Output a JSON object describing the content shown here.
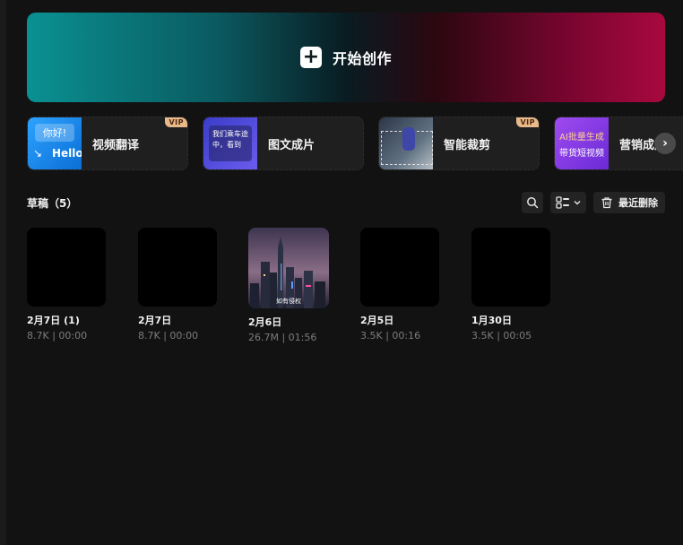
{
  "hero": {
    "label": "开始创作",
    "plus_icon": "plus-icon"
  },
  "tools": [
    {
      "label": "视频翻译",
      "vip": "VIP",
      "thumb_top": "你好!",
      "thumb_bottom": "Hello"
    },
    {
      "label": "图文成片",
      "thumb_text": "我们乘车途中，看到"
    },
    {
      "label": "智能裁剪",
      "vip": "VIP"
    },
    {
      "label": "营销成片",
      "thumb_l1": "AI批量生成",
      "thumb_l2": "带货短视频"
    }
  ],
  "drafts": {
    "title": "草稿（5）",
    "delete_label": "最近删除",
    "items": [
      {
        "title": "2月7日 (1)",
        "meta": "8.7K | 00:00"
      },
      {
        "title": "2月7日",
        "meta": "8.7K | 00:00"
      },
      {
        "title": "2月6日",
        "meta": "26.7M | 01:56",
        "overlay": "如有侵权"
      },
      {
        "title": "2月5日",
        "meta": "3.5K | 00:16"
      },
      {
        "title": "1月30日",
        "meta": "3.5K | 00:05"
      }
    ]
  },
  "colors": {
    "background": "#121212",
    "vip_badge": "#e9b98a",
    "hero_left": "#0a9192",
    "hero_right": "#a8093f"
  }
}
